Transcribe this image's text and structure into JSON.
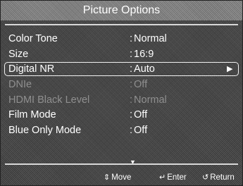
{
  "menu": {
    "title": "Picture Options",
    "items": [
      {
        "label": "Color Tone",
        "value": "Normal",
        "state": "normal"
      },
      {
        "label": "Size",
        "value": "16:9",
        "state": "normal"
      },
      {
        "label": "Digital NR",
        "value": "Auto",
        "state": "selected"
      },
      {
        "label": "DNIe",
        "value": "Off",
        "state": "disabled"
      },
      {
        "label": "HDMI Black Level",
        "value": "Normal",
        "state": "disabled"
      },
      {
        "label": "Film Mode",
        "value": "Off",
        "state": "normal"
      },
      {
        "label": "Blue Only Mode",
        "value": "Off",
        "state": "normal"
      }
    ],
    "submenu_arrow": "▶",
    "more_indicator": "▼"
  },
  "hints": {
    "move_icon": "⇕",
    "move_label": "Move",
    "enter_icon": "↵",
    "enter_label": "Enter",
    "return_icon": "↺",
    "return_label": "Return"
  },
  "colors": {
    "text": "#ffffff",
    "disabled": "#8f8f8f",
    "background": "#4a4a4a"
  }
}
